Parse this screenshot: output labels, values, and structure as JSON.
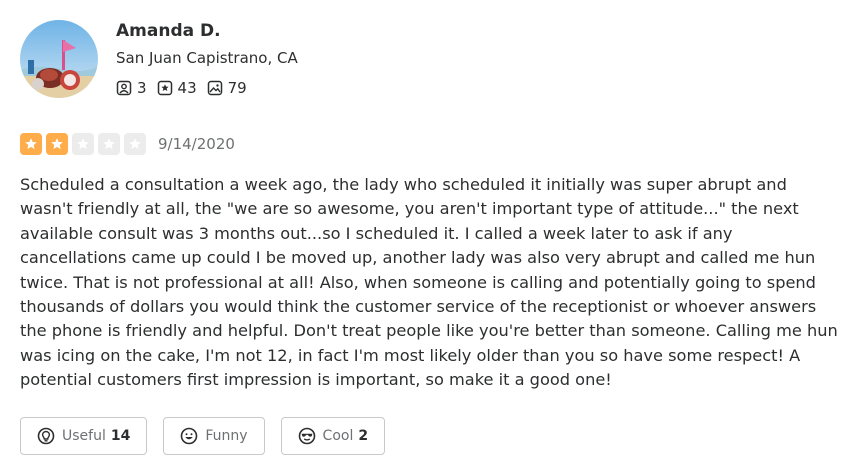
{
  "user": {
    "name": "Amanda D.",
    "location": "San Juan Capistrano, CA",
    "stats": {
      "friends": "3",
      "reviews": "43",
      "photos": "79"
    }
  },
  "review": {
    "rating": 2,
    "max_rating": 5,
    "date": "9/14/2020",
    "text": "Scheduled a consultation a week ago, the lady who scheduled it initially was super abrupt and wasn't friendly at all, the \"we are so awesome, you aren't important type of attitude...\" the next available consult was 3 months out...so I scheduled it. I called a week later to ask if any cancellations came up could I be moved up, another lady was also very abrupt and called me hun twice. That is not professional at all! Also, when someone is calling and potentially going to spend thousands of dollars you would think the customer service of the receptionist or whoever answers the phone is friendly and helpful. Don't treat people like you're better than someone. Calling me hun was icing on the cake, I'm not 12, in fact I'm most likely older than you so have some respect! A potential customers first impression is important, so make it a good one!"
  },
  "reactions": {
    "useful": {
      "label": "Useful",
      "count": "14"
    },
    "funny": {
      "label": "Funny",
      "count": ""
    },
    "cool": {
      "label": "Cool",
      "count": "2"
    }
  },
  "colors": {
    "star_filled": "#ffad4a",
    "star_empty": "#ececed",
    "text": "#2d2e2f",
    "muted": "#6e7072",
    "border": "#c8c9ca"
  },
  "icons": {
    "friends": "friends-icon",
    "reviews": "reviews-star-icon",
    "photos": "photos-icon",
    "useful": "useful-lightbulb-icon",
    "funny": "funny-face-icon",
    "cool": "cool-sunglasses-icon"
  }
}
